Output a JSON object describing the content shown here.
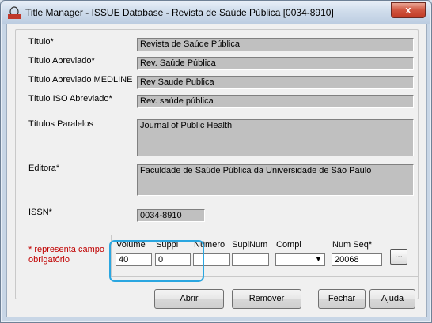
{
  "window": {
    "title": "Title Manager - ISSUE Database - Revista de Saúde Pública [0034-8910]",
    "close_label": "x"
  },
  "fields": {
    "titulo": {
      "label": "Título*",
      "value": "Revista de Saúde Pública"
    },
    "titulo_abreviado": {
      "label": "Título Abreviado*",
      "value": "Rev. Saúde Pública"
    },
    "titulo_medline": {
      "label": "Título Abreviado MEDLINE",
      "value": "Rev Saude Publica"
    },
    "titulo_iso": {
      "label": "Título ISO Abreviado*",
      "value": "Rev. saúde pública"
    },
    "titulos_paralelos": {
      "label": "Títulos Paralelos",
      "value": "Journal of Public Health"
    },
    "editora": {
      "label": "Editora*",
      "value": "Faculdade de Saúde Pública da Universidade de São Paulo"
    },
    "issn": {
      "label": "ISSN*",
      "value": "0034-8910"
    }
  },
  "required_note": "* representa campo obrigatório",
  "issue": {
    "volume": {
      "label": "Volume",
      "value": "40"
    },
    "suppl": {
      "label": "Suppl",
      "value": "0"
    },
    "numero": {
      "label": "Número",
      "value": ""
    },
    "suplnum": {
      "label": "SuplNum",
      "value": ""
    },
    "compl": {
      "label": "Compl",
      "value": ""
    },
    "num_seq": {
      "label": "Num Seq*",
      "value": "20068"
    },
    "ellipsis_label": "..."
  },
  "buttons": {
    "abrir": "Abrir",
    "remover": "Remover",
    "fechar": "Fechar",
    "ajuda": "Ajuda"
  }
}
